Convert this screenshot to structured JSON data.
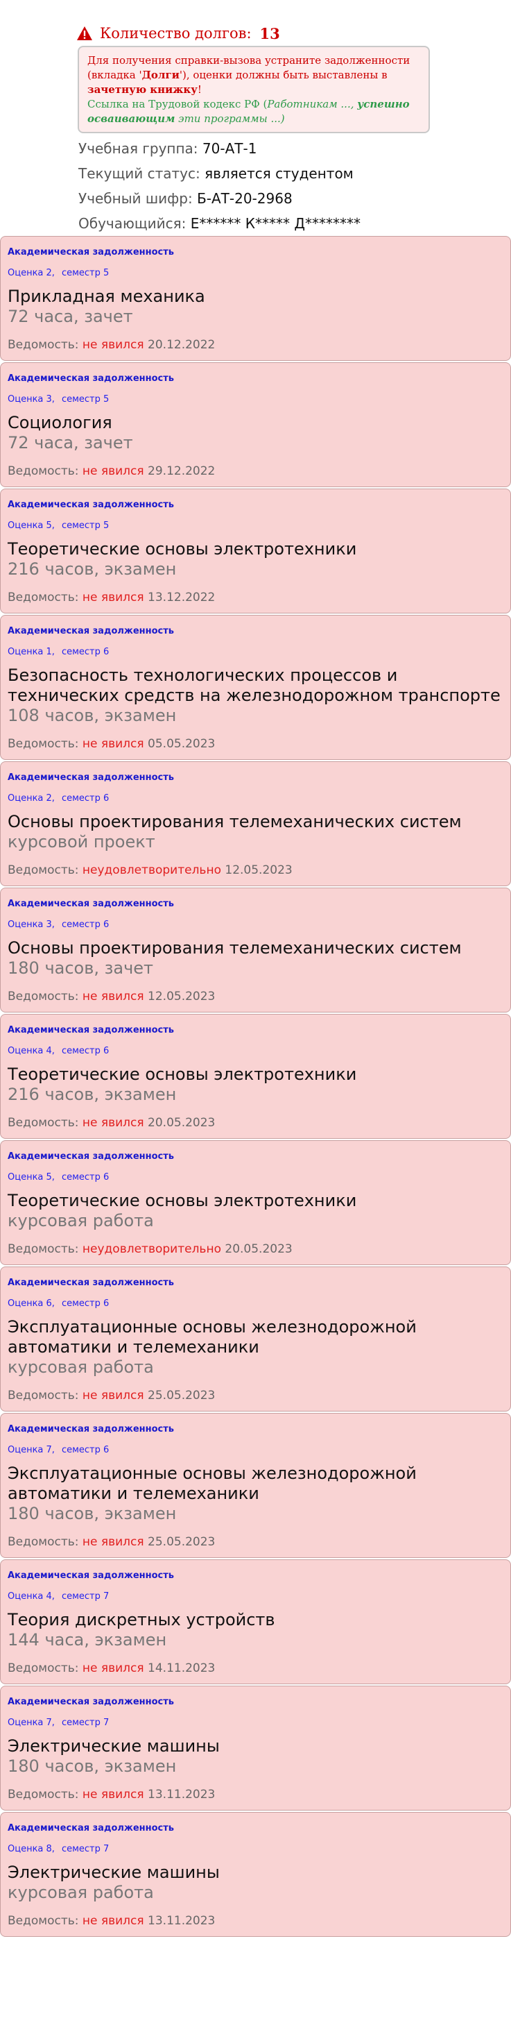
{
  "header": {
    "debt_label": "Количество долгов:",
    "debt_count": "13",
    "warning_icon": "warning-triangle-icon"
  },
  "notice": {
    "line1": "Для получения справки-вызова устраните задолженности",
    "line2a": "(вкладка '",
    "line2b": "Долги",
    "line2c": "'), оценки должны быть выставлены в",
    "line3": "зачетную книжку",
    "line3end": "!",
    "line4a": "Ссылка на Трудовой кодекс РФ (",
    "line4b": "Работникам ...,",
    "line4c": "успешно",
    "line5a": "осваивающим",
    "line5b": "эти программы ...)"
  },
  "student": {
    "group_label": "Учебная группа:",
    "group_value": "70-АТ-1",
    "status_label": "Текущий статус:",
    "status_value": "является студентом",
    "cipher_label": "Учебный шифр:",
    "cipher_value": "Б-АТ-20-2968",
    "name_label": "Обучающийся:",
    "name_value": "Е****** К***** Д********"
  },
  "colors": {
    "card_bg": "#f9d3d3",
    "accent_blue": "#1a1acc",
    "error_red": "#e02020",
    "notice_green": "#2e9b4a"
  },
  "debts": [
    {
      "kind": "Академическая задолженность",
      "grade": "Оценка 2,",
      "semester": "семестр 5",
      "subject": "Прикладная механика",
      "hours": "72 часа, зачет",
      "sheet_label": "Ведомость:",
      "result": "не явился",
      "date": "20.12.2022"
    },
    {
      "kind": "Академическая задолженность",
      "grade": "Оценка 3,",
      "semester": "семестр 5",
      "subject": "Социология",
      "hours": "72 часа, зачет",
      "sheet_label": "Ведомость:",
      "result": "не явился",
      "date": "29.12.2022"
    },
    {
      "kind": "Академическая задолженность",
      "grade": "Оценка 5,",
      "semester": "семестр 5",
      "subject": "Теоретические основы электротехники",
      "hours": "216 часов, экзамен",
      "sheet_label": "Ведомость:",
      "result": "не явился",
      "date": "13.12.2022"
    },
    {
      "kind": "Академическая задолженность",
      "grade": "Оценка 1,",
      "semester": "семестр 6",
      "subject": "Безопасность технологических процессов и технических средств на железнодорожном транспорте",
      "hours": "108 часов, экзамен",
      "sheet_label": "Ведомость:",
      "result": "не явился",
      "date": "05.05.2023"
    },
    {
      "kind": "Академическая задолженность",
      "grade": "Оценка 2,",
      "semester": "семестр 6",
      "subject": "Основы проектирования телемеханических систем",
      "hours": "курсовой проект",
      "sheet_label": "Ведомость:",
      "result": "неудовлетворительно",
      "date": "12.05.2023"
    },
    {
      "kind": "Академическая задолженность",
      "grade": "Оценка 3,",
      "semester": "семестр 6",
      "subject": "Основы проектирования телемеханических систем",
      "hours": "180 часов, зачет",
      "sheet_label": "Ведомость:",
      "result": "не явился",
      "date": "12.05.2023"
    },
    {
      "kind": "Академическая задолженность",
      "grade": "Оценка 4,",
      "semester": "семестр 6",
      "subject": "Теоретические основы электротехники",
      "hours": "216 часов, экзамен",
      "sheet_label": "Ведомость:",
      "result": "не явился",
      "date": "20.05.2023"
    },
    {
      "kind": "Академическая задолженность",
      "grade": "Оценка 5,",
      "semester": "семестр 6",
      "subject": "Теоретические основы электротехники",
      "hours": "курсовая работа",
      "sheet_label": "Ведомость:",
      "result": "неудовлетворительно",
      "date": "20.05.2023"
    },
    {
      "kind": "Академическая задолженность",
      "grade": "Оценка 6,",
      "semester": "семестр 6",
      "subject": "Эксплуатационные основы железнодорожной автоматики и телемеханики",
      "hours": "курсовая работа",
      "sheet_label": "Ведомость:",
      "result": "не явился",
      "date": "25.05.2023"
    },
    {
      "kind": "Академическая задолженность",
      "grade": "Оценка 7,",
      "semester": "семестр 6",
      "subject": "Эксплуатационные основы железнодорожной автоматики и телемеханики",
      "hours": "180 часов, экзамен",
      "sheet_label": "Ведомость:",
      "result": "не явился",
      "date": "25.05.2023"
    },
    {
      "kind": "Академическая задолженность",
      "grade": "Оценка 4,",
      "semester": "семестр 7",
      "subject": "Теория дискретных устройств",
      "hours": "144 часа, экзамен",
      "sheet_label": "Ведомость:",
      "result": "не явился",
      "date": "14.11.2023"
    },
    {
      "kind": "Академическая задолженность",
      "grade": "Оценка 7,",
      "semester": "семестр 7",
      "subject": "Электрические машины",
      "hours": "180 часов, экзамен",
      "sheet_label": "Ведомость:",
      "result": "не явился",
      "date": "13.11.2023"
    },
    {
      "kind": "Академическая задолженность",
      "grade": "Оценка 8,",
      "semester": "семестр 7",
      "subject": "Электрические машины",
      "hours": "курсовая работа",
      "sheet_label": "Ведомость:",
      "result": "не явился",
      "date": "13.11.2023"
    }
  ]
}
